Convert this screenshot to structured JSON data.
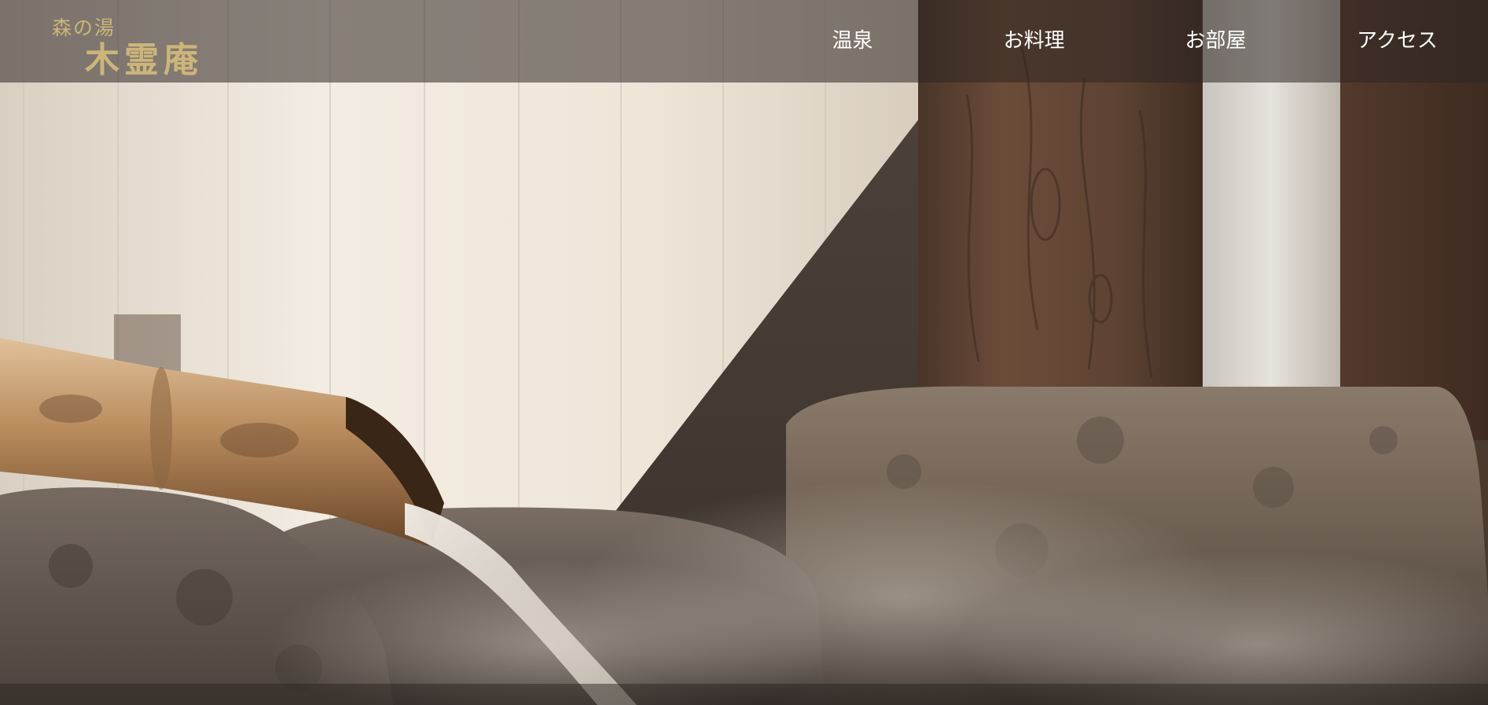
{
  "site": {
    "logo_small": "森の湯",
    "logo_big": "木霊庵"
  },
  "nav": {
    "items": [
      {
        "label": "温泉"
      },
      {
        "label": "お料理"
      },
      {
        "label": "お部屋"
      },
      {
        "label": "アクセス"
      }
    ]
  },
  "colors": {
    "logo_gold": "#cdb57a",
    "header_overlay": "rgba(45,38,34,0.55)",
    "nav_text": "#ffffff"
  },
  "hero": {
    "subject": "bamboo water spout pouring hot spring water over stones beside wooden posts"
  }
}
